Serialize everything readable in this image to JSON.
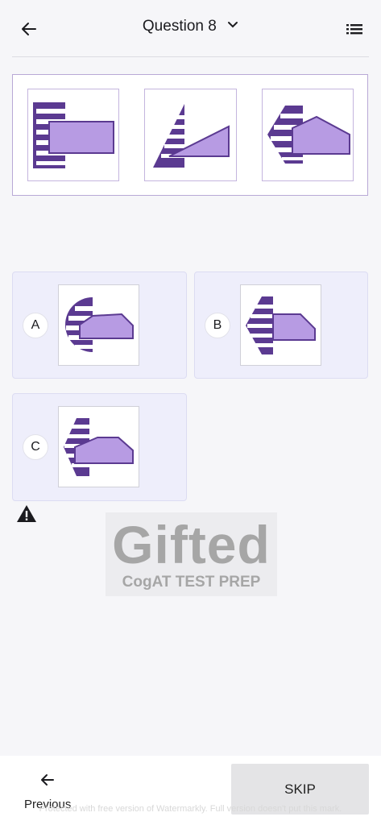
{
  "header": {
    "title": "Question 8",
    "back_icon": "arrow-left-icon",
    "dropdown_icon": "chevron-down-icon",
    "menu_icon": "list-icon"
  },
  "colors": {
    "dark_purple": "#5b3a91",
    "light_purple": "#b79be3",
    "card_bg": "#eeeefb"
  },
  "options": [
    {
      "letter": "A"
    },
    {
      "letter": "B"
    },
    {
      "letter": "C"
    }
  ],
  "warning_icon": "warning-icon",
  "logo": {
    "title": "Gifted",
    "subtitle": "CogAT TEST PREP"
  },
  "footer": {
    "previous_label": "Previous",
    "skip_label": "SKIP",
    "watermark": "Protected with free version of Watermarkly. Full version doesn't put this mark."
  }
}
